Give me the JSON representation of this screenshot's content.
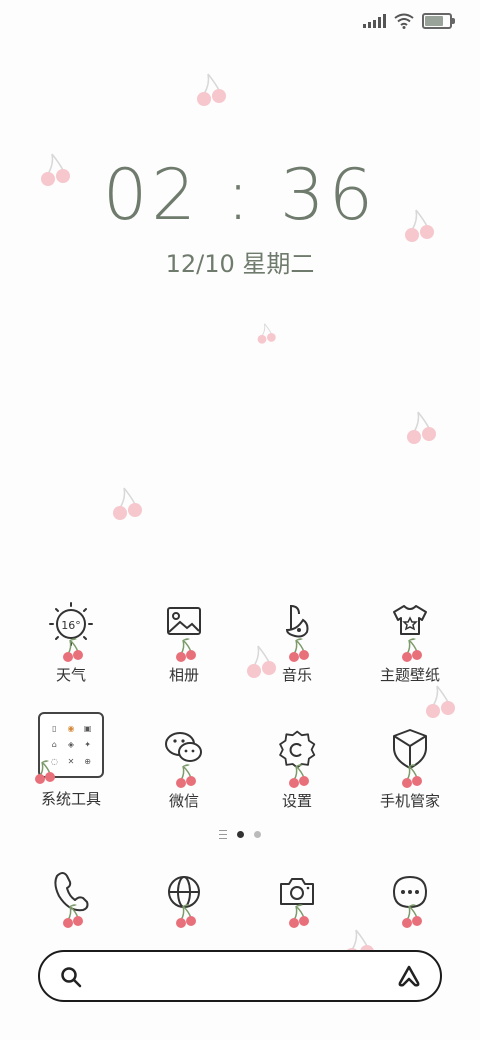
{
  "status_bar": {
    "signal_icon": "signal-icon",
    "wifi_icon": "wifi-icon",
    "battery_icon": "battery-charging-icon"
  },
  "clock": {
    "time": "02 : 36",
    "date": "12/10 星期二"
  },
  "apps_row1": [
    {
      "label": "天气",
      "icon": "weather-sun-icon",
      "temp": "16°"
    },
    {
      "label": "相册",
      "icon": "gallery-icon"
    },
    {
      "label": "音乐",
      "icon": "music-icon"
    },
    {
      "label": "主题壁纸",
      "icon": "theme-shirt-icon"
    }
  ],
  "apps_row2": [
    {
      "label": "系统工具",
      "icon": "folder-icon"
    },
    {
      "label": "微信",
      "icon": "wechat-icon"
    },
    {
      "label": "设置",
      "icon": "settings-icon"
    },
    {
      "label": "手机管家",
      "icon": "shield-icon"
    }
  ],
  "dock": [
    {
      "icon": "phone-icon"
    },
    {
      "icon": "browser-globe-icon"
    },
    {
      "icon": "camera-icon"
    },
    {
      "icon": "messages-icon"
    }
  ],
  "pager": {
    "pages": 2,
    "active": 1
  },
  "search": {
    "left_icon": "search-icon",
    "right_icon": "assistant-icon"
  },
  "colors": {
    "accent": "#6f7b6c",
    "cherry": "#e8707a",
    "stem": "#6b8e5a"
  }
}
